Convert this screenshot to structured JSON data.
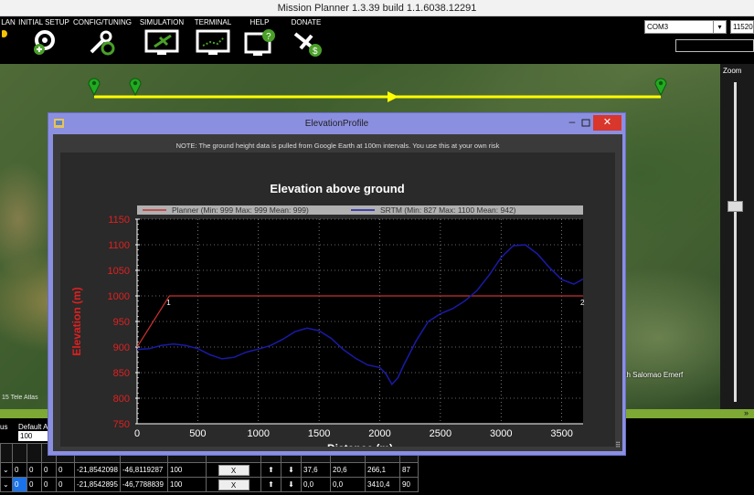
{
  "window": {
    "title": "Mission Planner 1.3.39 build 1.1.6038.12291"
  },
  "toolbar": {
    "buttons": [
      {
        "label": "LAN",
        "icon": "flight-plan-icon"
      },
      {
        "label": "INITIAL SETUP",
        "icon": "gear-plus-icon"
      },
      {
        "label": "CONFIG/TUNING",
        "icon": "wrench-gear-icon"
      },
      {
        "label": "SIMULATION",
        "icon": "monitor-plane-icon"
      },
      {
        "label": "TERMINAL",
        "icon": "monitor-terminal-icon"
      },
      {
        "label": "HELP",
        "icon": "monitor-help-icon"
      },
      {
        "label": "DONATE",
        "icon": "plane-dollar-icon"
      }
    ],
    "com_port": "COM3",
    "baud_rate": "11520"
  },
  "map": {
    "watermark": "15 Tele Atlas",
    "place_label": "ah Salomao Emerf",
    "accent_line": "#ffff00",
    "marker_color": "#22aa22"
  },
  "zoom": {
    "label": "Zoom"
  },
  "waypoints": {
    "status_label": "us",
    "default_alt_label": "Default A",
    "default_alt_value": "100",
    "rows": [
      {
        "c1": "0",
        "c2": "0",
        "c3": "0",
        "c4": "0",
        "lat": "-21,8542098",
        "lng": "-46,8119287",
        "alt": "100",
        "delete": "X",
        "grad": "37,6",
        "angle": "20,6",
        "dist": "266,1",
        "az": "87"
      },
      {
        "c1": "0",
        "c2": "0",
        "c3": "0",
        "c4": "0",
        "lat": "-21,8542895",
        "lng": "-46,7788839",
        "alt": "100",
        "delete": "X",
        "grad": "0,0",
        "angle": "0,0",
        "dist": "3410,4",
        "az": "90"
      }
    ]
  },
  "elevation_window": {
    "title": "ElevationProfile",
    "note": "NOTE: The ground height data is pulled from Google Earth at 100m intervals. You use this at your own risk",
    "close_label": "✕",
    "minimize_label": "–"
  },
  "chart_data": {
    "type": "line",
    "title": "Elevation above ground",
    "xlabel": "Distance (m)",
    "ylabel": "Elevation (m)",
    "xlim": [
      0,
      3676
    ],
    "ylim": [
      750,
      1150
    ],
    "xticks": [
      0,
      500,
      1000,
      1500,
      2000,
      2500,
      3000,
      3500
    ],
    "yticks": [
      750,
      800,
      850,
      900,
      950,
      1000,
      1050,
      1100,
      1150
    ],
    "grid": true,
    "legend_position": "top",
    "series": [
      {
        "name": "Planner (Min: 999 Max: 999 Mean: 999)",
        "color": "#c83030",
        "x": [
          0,
          266,
          3676
        ],
        "y": [
          900,
          1000,
          1000
        ]
      },
      {
        "name": "SRTM (Min: 827 Max: 1100 Mean: 942)",
        "color": "#1a1aa8",
        "x": [
          0,
          100,
          200,
          300,
          400,
          500,
          600,
          700,
          800,
          900,
          1000,
          1100,
          1200,
          1300,
          1400,
          1500,
          1600,
          1700,
          1800,
          1900,
          2000,
          2050,
          2100,
          2150,
          2200,
          2300,
          2400,
          2500,
          2600,
          2700,
          2800,
          2900,
          3000,
          3100,
          3200,
          3300,
          3400,
          3500,
          3600,
          3676
        ],
        "y": [
          895,
          897,
          903,
          906,
          903,
          897,
          885,
          877,
          880,
          890,
          896,
          903,
          915,
          930,
          937,
          932,
          917,
          895,
          878,
          865,
          860,
          848,
          827,
          840,
          866,
          912,
          950,
          965,
          975,
          990,
          1010,
          1040,
          1075,
          1098,
          1100,
          1082,
          1055,
          1032,
          1023,
          1033
        ]
      }
    ],
    "point_labels": [
      {
        "x": 266,
        "y": 1000,
        "text": "1"
      },
      {
        "x": 3676,
        "y": 1000,
        "text": "2"
      }
    ]
  }
}
